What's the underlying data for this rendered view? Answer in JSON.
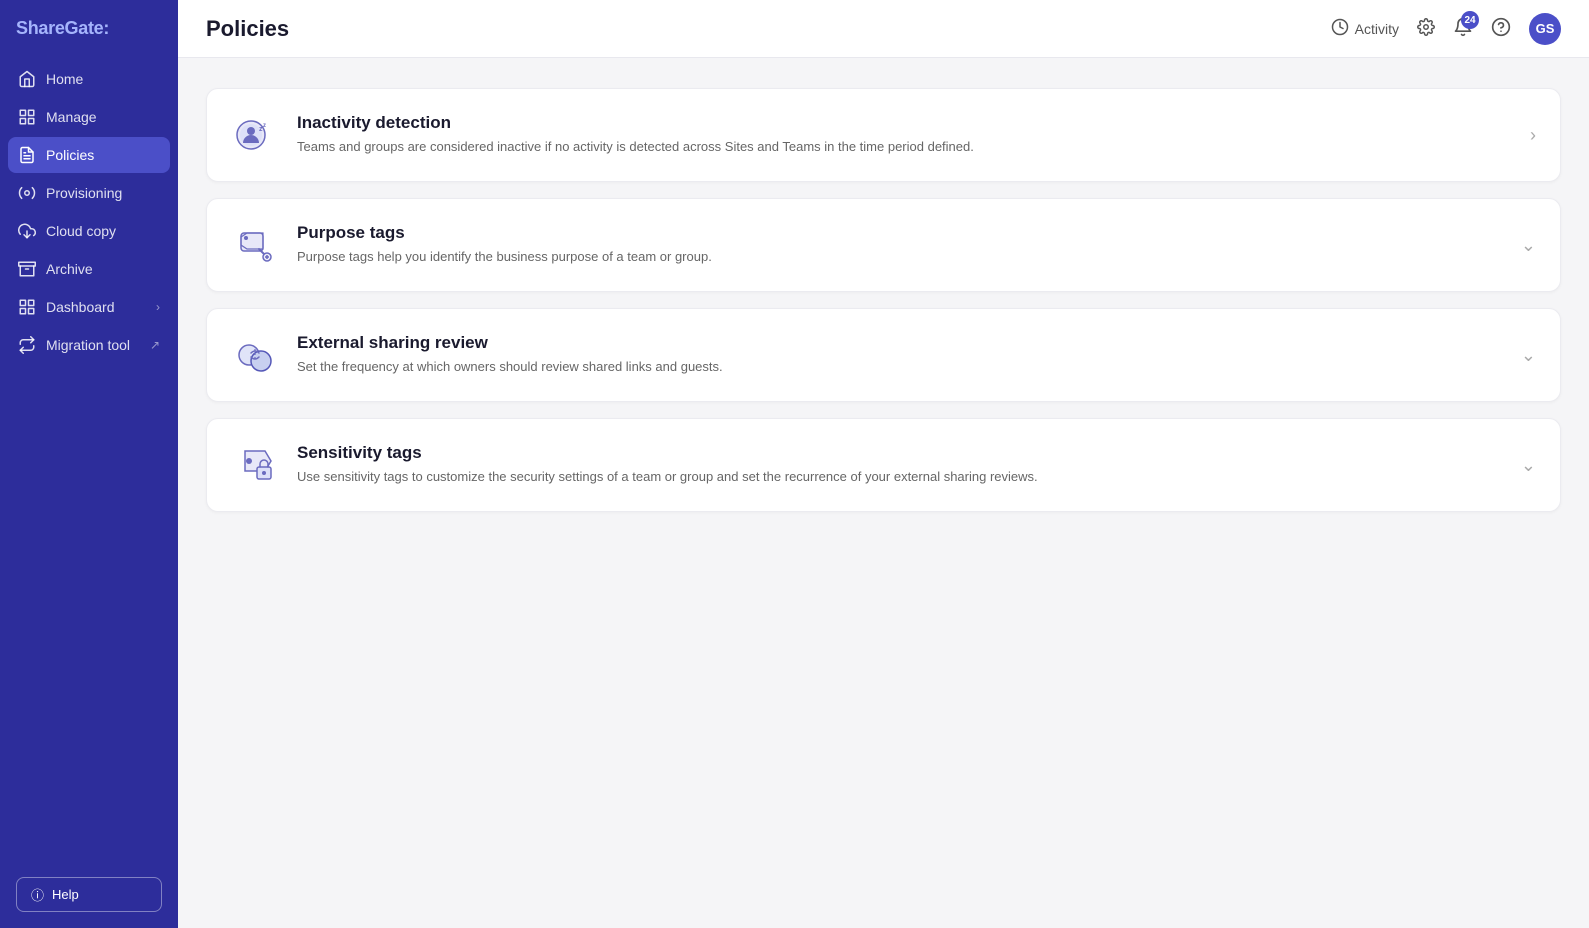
{
  "app": {
    "name": "ShareGate",
    "name_suffix": ":"
  },
  "sidebar": {
    "items": [
      {
        "id": "home",
        "label": "Home",
        "icon": "home",
        "active": false
      },
      {
        "id": "manage",
        "label": "Manage",
        "icon": "manage",
        "active": false
      },
      {
        "id": "policies",
        "label": "Policies",
        "icon": "policies",
        "active": true
      },
      {
        "id": "provisioning",
        "label": "Provisioning",
        "icon": "provisioning",
        "active": false
      },
      {
        "id": "cloud-copy",
        "label": "Cloud copy",
        "icon": "cloud",
        "active": false
      },
      {
        "id": "archive",
        "label": "Archive",
        "icon": "archive",
        "active": false
      },
      {
        "id": "dashboard",
        "label": "Dashboard",
        "icon": "dashboard",
        "active": false,
        "has_chevron": true
      },
      {
        "id": "migration-tool",
        "label": "Migration tool",
        "icon": "migration",
        "active": false,
        "has_ext": true
      }
    ],
    "help_label": "Help"
  },
  "header": {
    "title": "Policies",
    "activity_label": "Activity",
    "notification_count": "24",
    "avatar_initials": "GS"
  },
  "policies": [
    {
      "id": "inactivity-detection",
      "title": "Inactivity detection",
      "description": "Teams and groups are considered inactive if no activity is detected across Sites and Teams in the time period defined.",
      "icon": "inactivity"
    },
    {
      "id": "purpose-tags",
      "title": "Purpose tags",
      "description": "Purpose tags help you identify the business purpose of a team or group.",
      "icon": "purpose-tags"
    },
    {
      "id": "external-sharing-review",
      "title": "External sharing review",
      "description": "Set the frequency at which owners should review shared links and guests.",
      "icon": "external-sharing"
    },
    {
      "id": "sensitivity-tags",
      "title": "Sensitivity tags",
      "description": "Use sensitivity tags to customize the security settings of a team or group and set the recurrence of your external sharing reviews.",
      "icon": "sensitivity-tags"
    }
  ]
}
